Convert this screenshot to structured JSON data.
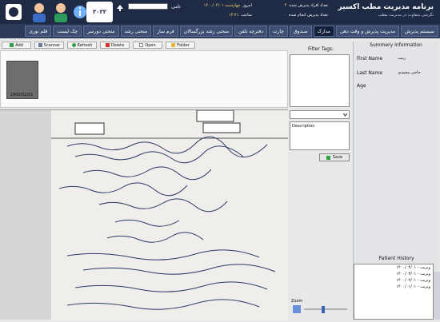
{
  "app": {
    "title": "برنامه مدیریت مطب اکسیر",
    "subtitle": "نگرشی متفاوت در مدیریت مطب",
    "counter": "۳۰۳۳ پشتیبانی"
  },
  "header": {
    "user_label": "نامی",
    "stats": [
      {
        "label": "تعداد افراد پذیرش شده",
        "value": "۴"
      },
      {
        "label": "امروز",
        "value": "چهارشنبه ۱۴۰۰/۰۴/۰۱"
      },
      {
        "label": "تعداد پذیرش انجام شده",
        "value": "۰"
      },
      {
        "label": "ساعت",
        "value": "۱۳:۴۱"
      }
    ]
  },
  "tabs": [
    {
      "label": "سیستم پذیرش"
    },
    {
      "label": "مدیریت پذیرش و وقت دهی"
    },
    {
      "label": "مدارک"
    },
    {
      "label": "صندوق"
    },
    {
      "label": "چارت"
    },
    {
      "label": "دفترچه تلفن"
    },
    {
      "label": "منحنی رشد بزرگسالان"
    },
    {
      "label": "فرم ساز"
    },
    {
      "label": "منحنی رشد"
    },
    {
      "label": "منحنی دورسر"
    },
    {
      "label": "چک لیست"
    },
    {
      "label": "قلم نوری"
    }
  ],
  "toolbar": {
    "add": "Add",
    "scanner": "Scanner",
    "refresh": "Refresh",
    "delete": "Delete",
    "open": "Open",
    "folder": "Folder"
  },
  "thumbnail": {
    "caption": "1400/02/01"
  },
  "filter": {
    "label": "Filter Tags:",
    "description": "Description",
    "save": "Save",
    "zoom": "Zoom"
  },
  "summary": {
    "title": "Summery Information",
    "first_name_label": "First Name",
    "first_name": "زینب",
    "last_name_label": "Last Name",
    "last_name": "حاجی محمدی",
    "age_label": "Age"
  },
  "history": {
    "title": "Patient History",
    "items": [
      "ویزیت - ۱۴۰۰/۰۴/۰۱",
      "ویزیت - ۱۴۰۰/۰۳/۰۱",
      "ویزیت - ۱۴۰۰/۰۲/۰۱",
      "ویزیت - ۱۴۰۰/۰۱/۰۱"
    ]
  },
  "colors": {
    "header": "#1f2a44",
    "nav": "#2c3a5a",
    "accent": "#ffd76a"
  }
}
